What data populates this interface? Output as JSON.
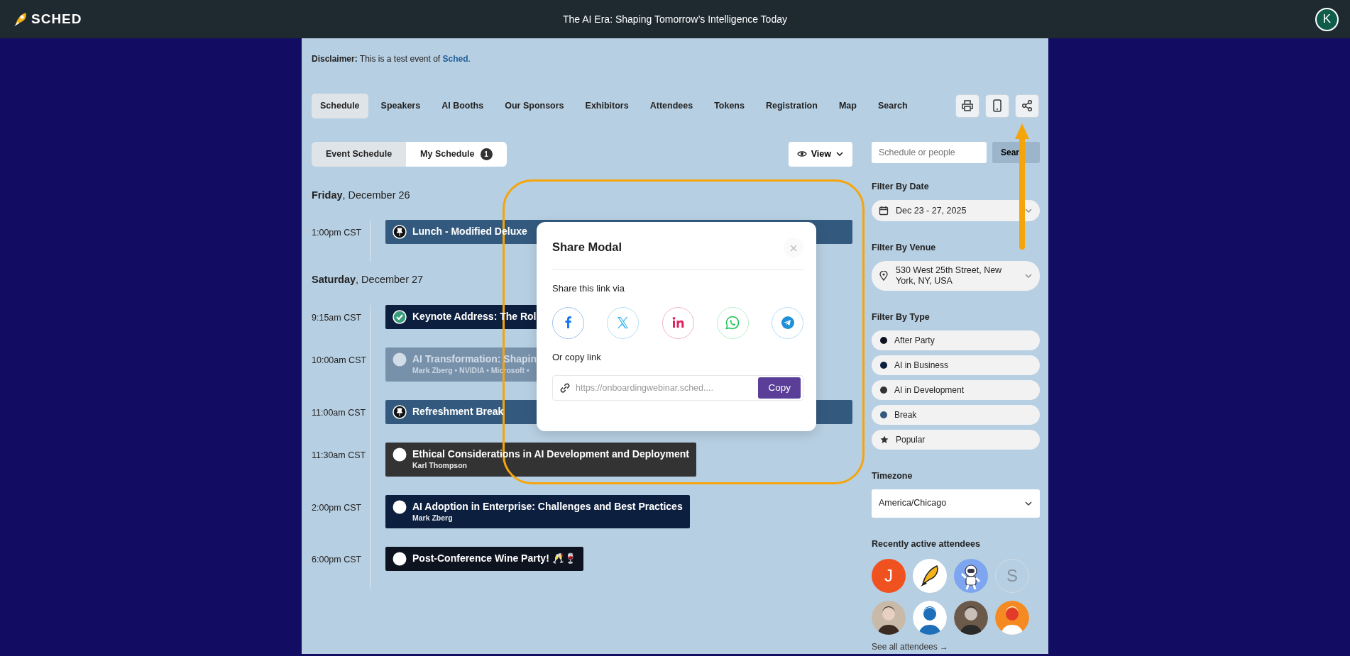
{
  "header": {
    "logo": "SCHED",
    "title": "The AI Era: Shaping Tomorrow’s Intelligence Today",
    "avatar": "K"
  },
  "disclaimer": {
    "text": "**Disclaimer:** This is a test event of ",
    "link": "Sched",
    "end": "."
  },
  "nav_tabs": [
    {
      "label": "Schedule",
      "selected": true
    },
    {
      "label": "Speakers",
      "selected": false
    },
    {
      "label": "AI Booths",
      "selected": false
    },
    {
      "label": "Our Sponsors",
      "selected": false
    },
    {
      "label": "Exhibitors",
      "selected": false
    },
    {
      "label": "Attendees",
      "selected": false
    },
    {
      "label": "Tokens",
      "selected": false
    },
    {
      "label": "Registration",
      "selected": false
    },
    {
      "label": "Map",
      "selected": false
    },
    {
      "label": "Search",
      "selected": false
    }
  ],
  "toolbar_buttons": [
    {
      "kind": "print"
    },
    {
      "kind": "mobile"
    },
    {
      "kind": "share"
    }
  ],
  "schedule_toggle": [
    {
      "label": "Event Schedule",
      "selected": true
    },
    {
      "label": "My Schedule",
      "selected": false,
      "badge": "1"
    }
  ],
  "view_button": "View",
  "days": [
    {
      "heading": "**Friday**, December 26",
      "slots": [
        {
          "time": "1:00pm CST",
          "title": "Lunch - Modified Deluxe",
          "color": "#335a7e",
          "kind": "pinned",
          "faded": false
        }
      ]
    },
    {
      "heading": "**Saturday**, December 27",
      "slots": [
        {
          "time": "9:15am CST",
          "title": "Keynote Address: The Rol",
          "color": "#0c1f3f",
          "kind": "added",
          "faded": false
        },
        {
          "time": "10:00am CST",
          "title": "AI Transformation: Shapin",
          "speakers": "Mark Zberg • NVIDIA • Microsoft •",
          "color": "#7891ab",
          "kind": "open",
          "faded": true
        },
        {
          "time": "11:00am CST",
          "title": "Refreshment Break",
          "color": "#335a7e",
          "kind": "pinned",
          "faded": false
        },
        {
          "time": "11:30am CST",
          "title": "Ethical Considerations in AI Development and Deployment",
          "speakers": "Karl Thompson",
          "color": "#333333",
          "kind": "open",
          "faded": false
        },
        {
          "time": "2:00pm CST",
          "title": "AI Adoption in Enterprise: Challenges and Best Practices",
          "speakers": "Mark Zberg",
          "color": "#0c1f3f",
          "kind": "open",
          "faded": false
        },
        {
          "time": "6:00pm CST",
          "title": "Post-Conference Wine Party! 🥂🍷",
          "color": "#0e1320",
          "kind": "open",
          "faded": false
        }
      ]
    }
  ],
  "search": {
    "placeholder": "Schedule or people",
    "button": "Sear"
  },
  "filters": {
    "date": {
      "label": "Filter By Date",
      "value": "Dec 23 - 27, 2025"
    },
    "venue": {
      "label": "Filter By Venue",
      "value": "530 West 25th Street, New York, NY, USA"
    },
    "type_label": "Filter By Type",
    "types": [
      {
        "label": "After Party",
        "kind": "dot",
        "color": "#0e1320"
      },
      {
        "label": "AI in Business",
        "kind": "dot",
        "color": "#0c1f3f"
      },
      {
        "label": "AI in Development",
        "kind": "dot",
        "color": "#333333"
      },
      {
        "label": "Break",
        "kind": "dot",
        "color": "#335a7e"
      },
      {
        "label": "Popular",
        "kind": "star"
      }
    ],
    "timezone": {
      "label": "Timezone",
      "value": "America/Chicago"
    }
  },
  "attendees": {
    "title": "Recently active attendees",
    "items": [
      {
        "kind": "letter",
        "text": "J"
      },
      {
        "kind": "logo"
      },
      {
        "kind": "astronaut"
      },
      {
        "kind": "outline",
        "text": "S"
      },
      {
        "kind": "picture"
      },
      {
        "kind": "picture"
      },
      {
        "kind": "picture"
      },
      {
        "kind": "picture"
      }
    ],
    "link": "See all attendees →"
  },
  "modal": {
    "title": "Share Modal",
    "share_label": "Share this link via",
    "networks": [
      {
        "kind": "facebook"
      },
      {
        "kind": "x"
      },
      {
        "kind": "linkedin"
      },
      {
        "kind": "whatsapp"
      },
      {
        "kind": "telegram"
      }
    ],
    "copy_label": "Or copy link",
    "url": "https://onboardingwebinar.sched....",
    "copy_button": "Copy"
  },
  "annotations": {
    "highlight_outline": true,
    "pointer_arrow": true
  }
}
